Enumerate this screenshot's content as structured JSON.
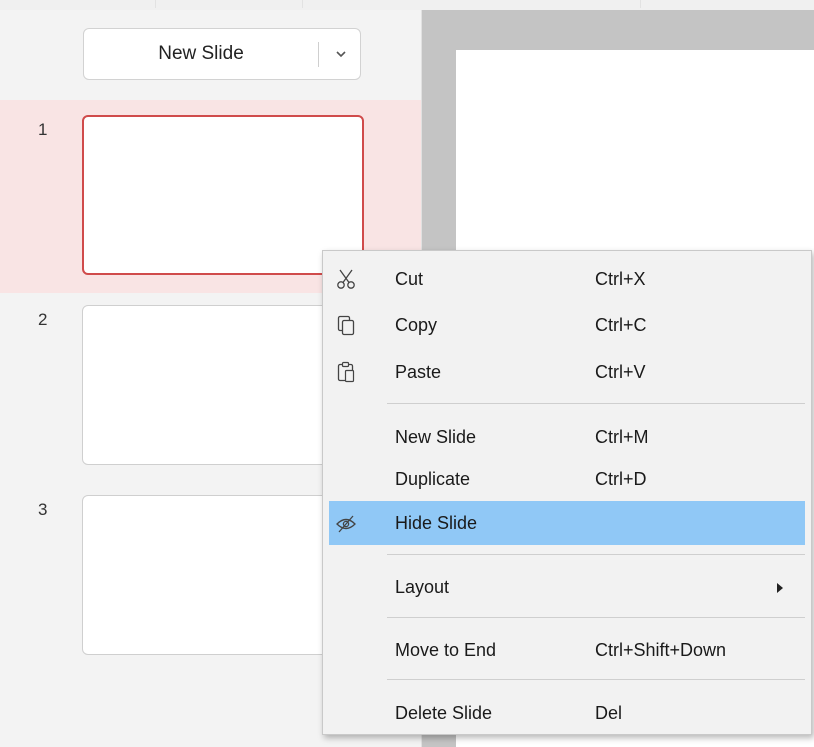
{
  "colors": {
    "selected_row_bg": "#f9e4e4",
    "selected_thumb_border": "#d04b4b",
    "menu_highlight": "#90c8f6",
    "canvas_bg": "#c4c4c4"
  },
  "sidebar": {
    "new_slide_button": {
      "label": "New Slide",
      "dropdown_icon": "chevron-down-icon"
    },
    "slides": [
      {
        "number": "1",
        "selected": true
      },
      {
        "number": "2",
        "selected": false
      },
      {
        "number": "3",
        "selected": false
      }
    ]
  },
  "context_menu": {
    "items": [
      {
        "label": "Cut",
        "shortcut": "Ctrl+X",
        "icon": "scissors-icon"
      },
      {
        "label": "Copy",
        "shortcut": "Ctrl+C",
        "icon": "copy-icon"
      },
      {
        "label": "Paste",
        "shortcut": "Ctrl+V",
        "icon": "paste-icon"
      },
      {
        "label": "New Slide",
        "shortcut": "Ctrl+M"
      },
      {
        "label": "Duplicate",
        "shortcut": "Ctrl+D"
      },
      {
        "label": "Hide Slide",
        "shortcut": "",
        "icon": "eye-slash-icon",
        "highlighted": true
      },
      {
        "label": "Layout",
        "shortcut": "",
        "submenu": true,
        "icon": "submenu-arrow-icon"
      },
      {
        "label": "Move to End",
        "shortcut": "Ctrl+Shift+Down"
      },
      {
        "label": "Delete Slide",
        "shortcut": "Del"
      }
    ]
  }
}
